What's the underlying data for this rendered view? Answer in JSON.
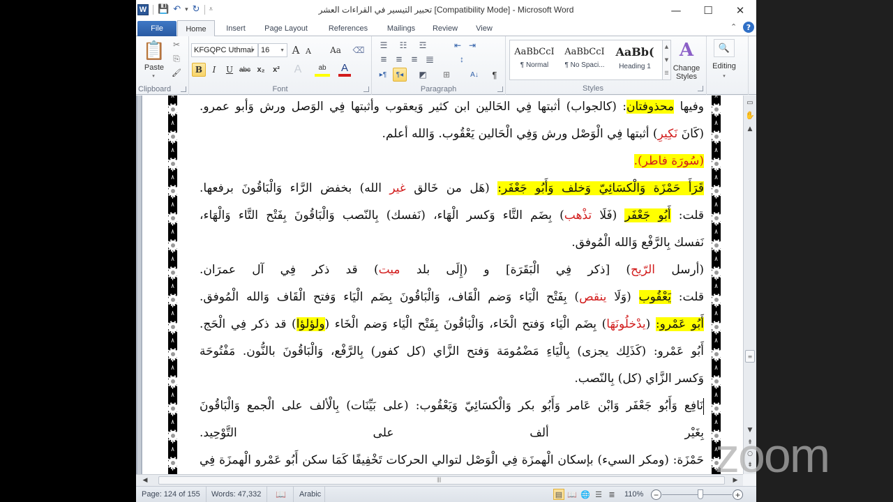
{
  "window": {
    "title": "تحبير التيسير في القراءات العشر [Compatibility Mode]  -  Microsoft Word",
    "app_icon": "W",
    "controls": {
      "minimize": "—",
      "maximize": "☐",
      "close": "✕"
    }
  },
  "quick_access": {
    "save_icon": "💾",
    "undo_icon": "↶",
    "undo_dd": "▾",
    "redo_icon": "↻",
    "customize_icon": "⩡"
  },
  "tabs": [
    {
      "label": "File"
    },
    {
      "label": "Home",
      "active": true
    },
    {
      "label": "Insert"
    },
    {
      "label": "Page Layout"
    },
    {
      "label": "References"
    },
    {
      "label": "Mailings"
    },
    {
      "label": "Review"
    },
    {
      "label": "View"
    }
  ],
  "tabs_right": {
    "minimize_ribbon_icon": "⌃",
    "help_icon": "?"
  },
  "ribbon": {
    "clipboard": {
      "label": "Clipboard",
      "paste": "Paste",
      "paste_dd": "▾",
      "cut_icon": "✂",
      "copy_icon": "⎘",
      "format_painter_icon": "🖌"
    },
    "font": {
      "label": "Font",
      "font_name": "KFGQPC Uthmai",
      "font_size": "16",
      "grow": "A",
      "shrink": "A",
      "change_case": "Aa",
      "clear_format_icon": "⌫",
      "bold": "B",
      "italic": "I",
      "underline": "U",
      "strike": "abc",
      "subscript": "x₂",
      "superscript": "x²",
      "text_effects": "A",
      "highlight": "ab",
      "font_color": "A",
      "highlight_color": "#ffff00",
      "font_color_value": "#d21c1c"
    },
    "paragraph": {
      "label": "Paragraph",
      "bullets_icon": "☰",
      "numbering_icon": "☷",
      "multilevel_icon": "☲",
      "decrease_indent_icon": "⇤",
      "increase_indent_icon": "⇥",
      "align_left_icon": "≡",
      "center_icon": "≡",
      "align_right_icon": "≡",
      "justify_icon": "≣",
      "line_spacing_icon": "↕",
      "ltr_icon": "▸¶",
      "rtl_icon": "¶◂",
      "shading_icon": "◩",
      "borders_icon": "⊞",
      "sort_icon": "A↓",
      "show_marks_icon": "¶"
    },
    "styles": {
      "label": "Styles",
      "items": [
        {
          "preview": "AaBbCcI",
          "name": "¶ Normal"
        },
        {
          "preview": "AaBbCcI",
          "name": "¶ No Spaci..."
        },
        {
          "preview": "AaBb(",
          "name": "Heading 1"
        }
      ],
      "change_styles": "Change Styles",
      "change_styles_dd": "▾"
    },
    "editing": {
      "label": "Editing",
      "icon": "🔍",
      "dd": "▾"
    }
  },
  "document": {
    "lines": [
      {
        "segments": [
          {
            "t": "وفيها "
          },
          {
            "t": "محذوفتان",
            "hl": true
          },
          {
            "t": ": (كالجواب) أثبتها فِي الحَالين ابن كثير وَيعقوب وأثبتها فِي الوَصل ورش وَأبو عمرو."
          }
        ]
      },
      {
        "ragged": true,
        "segments": [
          {
            "t": "(كَانَ "
          },
          {
            "t": "نَكِيرِ",
            "red": true
          },
          {
            "t": ") أثبتها فِي الْوَصْل ورش وَفِي الْحَالين يَعْقُوب. وَالله أعلم."
          }
        ]
      },
      {
        "ragged": true,
        "segments": [
          {
            "t": "(سُورَة فاطر).",
            "hl": true,
            "red": true
          }
        ]
      },
      {
        "segments": [
          {
            "t": "قَرَأَ حَمْزَة وَالْكسَائِيّ وَخلف وَأَبُو جَعْفَر:",
            "hl": true
          },
          {
            "t": " (هَل من خَالق "
          },
          {
            "t": "غير",
            "red": true
          },
          {
            "t": " الله) بخفض الرَّاء وَالْبَاقُونَ برفعها."
          }
        ]
      },
      {
        "segments": [
          {
            "t": "قلت: "
          },
          {
            "t": "أَبُو جَعْفَر",
            "hl": true
          },
          {
            "t": " (فَلَا "
          },
          {
            "t": "تذْهب",
            "red": true
          },
          {
            "t": ") بِضَم التَّاء وَكسر الْهَاء، (نَفسك) بِالنّصب وَالْبَاقُونَ بِفَتْح التَّاء وَالْهَاء،"
          }
        ]
      },
      {
        "ragged": true,
        "segments": [
          {
            "t": "نَفسك بِالرَّفْع وَالله الْمُوفق."
          }
        ]
      },
      {
        "segments": [
          {
            "t": "(أرسل "
          },
          {
            "t": "الرّيح",
            "red": true
          },
          {
            "t": ") [ذكر فِي الْبَقَرَة] و (إِلَى بلد "
          },
          {
            "t": "ميت",
            "red": true
          },
          {
            "t": ") قد ذكر فِي آل عمرَان."
          }
        ]
      },
      {
        "segments": [
          {
            "t": "قلت: "
          },
          {
            "t": "يَعْقُوب",
            "hl": true
          },
          {
            "t": " (وَلَا "
          },
          {
            "t": "ينقص",
            "red": true
          },
          {
            "t": ") بِفَتْح الْيَاء وَضم الْقَاف، وَالْبَاقُونَ بِضَم الْيَاء وَفتح الْقَاف وَالله الْمُوفق."
          }
        ]
      },
      {
        "segments": [
          {
            "t": "أَبُو عَمْرو:",
            "hl": true
          },
          {
            "t": " ("
          },
          {
            "t": "يدْخلُونَهَا",
            "red": true
          },
          {
            "t": ") بِضَم الْيَاء وَفتح الْخَاء، وَالْبَاقُونَ بِفَتْح الْيَاء وَضم الْخَاء ("
          },
          {
            "t": "ولؤلؤا",
            "hl": true
          },
          {
            "t": ") قد ذكر فِي الْحَج."
          }
        ]
      },
      {
        "segments": [
          {
            "t": "أَبُو عَمْرو: (كَذَلِك يجزى) بِالْيَاءِ مَضْمُومَة وَفتح الزَّاي (كل كفور) بِالرَّفْع، وَالْبَاقُونَ بالنُّون. مَفْتُوحَة"
          }
        ]
      },
      {
        "ragged": true,
        "segments": [
          {
            "t": "وَكسر الزَّاي (كل) بِالنّصب."
          }
        ]
      },
      {
        "cursor": true,
        "segments": [
          {
            "t": "نَافِع وَأَبُو جَعْفَر وَابْن عَامر وَأَبُو بكر وَالْكسَائِيّ وَيَعْقُوب: (على بَيِّنَات) بِالْألف على الْجمع وَالْبَاقُونَ"
          }
        ]
      },
      {
        "segments": [
          {
            "t": "بِغَيْر ألف على التَّوْحِيد."
          }
        ]
      },
      {
        "segments": [
          {
            "t": "حَمْزَة: (ومكر السيء) بإسكان الْهمزَة فِي الْوَصْل لتوالي الحركات تَخْفِيفًا كَمَا سكن أَبُو عَمْرو الْهمزَة فِي"
          }
        ]
      }
    ]
  },
  "vertical_scroll": {
    "view_ruler_icon": "▭",
    "hand_icon": "✋",
    "up": "▲",
    "down": "▼",
    "thumb_grip": "≡",
    "prev_page": "⇞",
    "browse_object": "○",
    "next_page": "⇟",
    "position": 0.78
  },
  "horizontal_scroll": {
    "left": "◀",
    "right": "▶",
    "grip": "||||"
  },
  "statusbar": {
    "page": "Page: 124 of 155",
    "words": "Words: 47,332",
    "proofing_icon": "📖",
    "language": "Arabic",
    "views": [
      {
        "name": "print-layout",
        "icon": "▤",
        "active": true
      },
      {
        "name": "full-screen-reading",
        "icon": "📖"
      },
      {
        "name": "web-layout",
        "icon": "🌐"
      },
      {
        "name": "outline",
        "icon": "☰"
      },
      {
        "name": "draft",
        "icon": "≣"
      }
    ],
    "zoom_level": "110%",
    "zoom_minus": "−",
    "zoom_plus": "+",
    "zoom_fraction": 0.55
  },
  "watermark": {
    "text": "zoom"
  }
}
